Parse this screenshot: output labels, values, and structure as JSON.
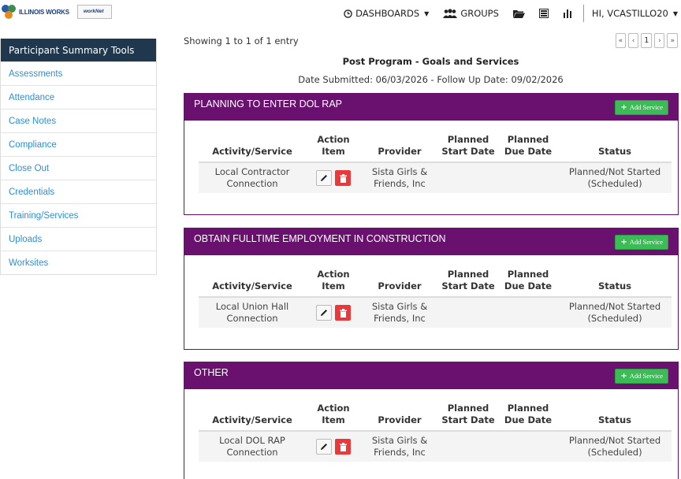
{
  "logo": {
    "primary_text": "ILLINOIS WORKS",
    "partner_text": "workNet"
  },
  "nav": {
    "dashboards_label": "DASHBOARDS",
    "groups_label": "GROUPS",
    "user_label": "HI, VCASTILLO20"
  },
  "sidebar": {
    "heading": "Participant Summary Tools",
    "items": [
      {
        "label": "Assessments"
      },
      {
        "label": "Attendance"
      },
      {
        "label": "Case Notes"
      },
      {
        "label": "Compliance"
      },
      {
        "label": "Close Out"
      },
      {
        "label": "Credentials"
      },
      {
        "label": "Training/Services"
      },
      {
        "label": "Uploads"
      },
      {
        "label": "Worksites"
      }
    ]
  },
  "listing": {
    "showing_text": "Showing 1 to 1 of 1 entry",
    "pager": {
      "first": "«",
      "prev": "‹",
      "current": "1",
      "next": "›",
      "last": "»"
    }
  },
  "main": {
    "title": "Post Program - Goals and Services",
    "dates": "Date Submitted: 06/03/2026 - Follow Up Date: 09/02/2026",
    "add_service_label": "Add Service",
    "goals": [
      {
        "title": "PLANNING TO ENTER DOL RAP",
        "headers": [
          "Activity/Service",
          "Action Item",
          "Provider",
          "Planned Start Date",
          "Planned Due Date",
          "Status"
        ],
        "row": {
          "activity": "Local Contractor Connection",
          "provider": "Sista Girls & Friends, Inc",
          "start": "",
          "due": "",
          "status": "Planned/Not Started (Scheduled)"
        }
      },
      {
        "title": "OBTAIN FULLTIME EMPLOYMENT IN CONSTRUCTION",
        "headers": [
          "Activity/Service",
          "Action Item",
          "Provider",
          "Planned Start Date",
          "Planned Due Date",
          "Status"
        ],
        "row": {
          "activity": "Local Union Hall Connection",
          "provider": "Sista Girls & Friends, Inc",
          "start": "",
          "due": "",
          "status": "Planned/Not Started (Scheduled)"
        }
      },
      {
        "title": "OTHER",
        "headers": [
          "Activity/Service",
          "Action Item",
          "Provider",
          "Planned Start Date",
          "Planned Due Date",
          "Status"
        ],
        "row": {
          "activity": "Local DOL RAP Connection",
          "provider": "Sista Girls & Friends, Inc",
          "start": "",
          "due": "",
          "status": "Planned/Not Started (Scheduled)"
        }
      }
    ]
  },
  "colors": {
    "panel_header": "#6a1170",
    "sidebar_header": "#20384d",
    "link": "#2e8fd3",
    "add_button": "#3dbb57",
    "delete_button": "#e83a3a"
  },
  "icons": {
    "dashboards": "clock-icon",
    "groups": "group-icon",
    "folder": "folder-icon",
    "list": "list-icon",
    "chart": "bar-chart-icon",
    "edit": "pencil-icon",
    "delete": "trash-icon",
    "add": "plus-icon"
  }
}
